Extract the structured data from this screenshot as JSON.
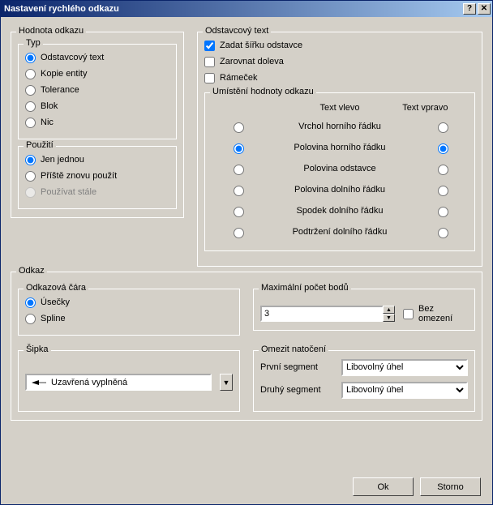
{
  "title": "Nastavení rychlého odkazu",
  "groups": {
    "hodnota_odkazu": "Hodnota odkazu",
    "typ": "Typ",
    "pouziti": "Použití",
    "odstavcovy_text": "Odstavcový text",
    "umisteni": "Umístění hodnoty odkazu",
    "odkaz": "Odkaz",
    "odkazova_cara": "Odkazová čára",
    "max_bodu": "Maximální počet bodů",
    "sipka": "Šipka",
    "omezit": "Omezit natočení"
  },
  "typ_options": [
    "Odstavcový text",
    "Kopie entity",
    "Tolerance",
    "Blok",
    "Nic"
  ],
  "pouziti_options": [
    "Jen jednou",
    "Příště znovu použít",
    "Používat stále"
  ],
  "checks": {
    "zadat": "Zadat šířku odstavce",
    "zarovnat": "Zarovnat doleva",
    "ramecek": "Rámeček",
    "bez_omezeni": "Bez omezení"
  },
  "umisteni_head": {
    "left": "Text vlevo",
    "right": "Text vpravo"
  },
  "umisteni_rows": [
    "Vrchol horního řádku",
    "Polovina horního řádku",
    "Polovina odstavce",
    "Polovina dolního řádku",
    "Spodek dolního řádku",
    "Podtržení dolního řádku"
  ],
  "cara_options": [
    "Úsečky",
    "Spline"
  ],
  "max_value": "3",
  "arrow_label": "Uzavřená vyplněná",
  "segment_labels": {
    "prvni": "První segment",
    "druhy": "Druhý segment"
  },
  "angle_option": "Libovolný úhel",
  "buttons": {
    "ok": "Ok",
    "storno": "Storno"
  }
}
